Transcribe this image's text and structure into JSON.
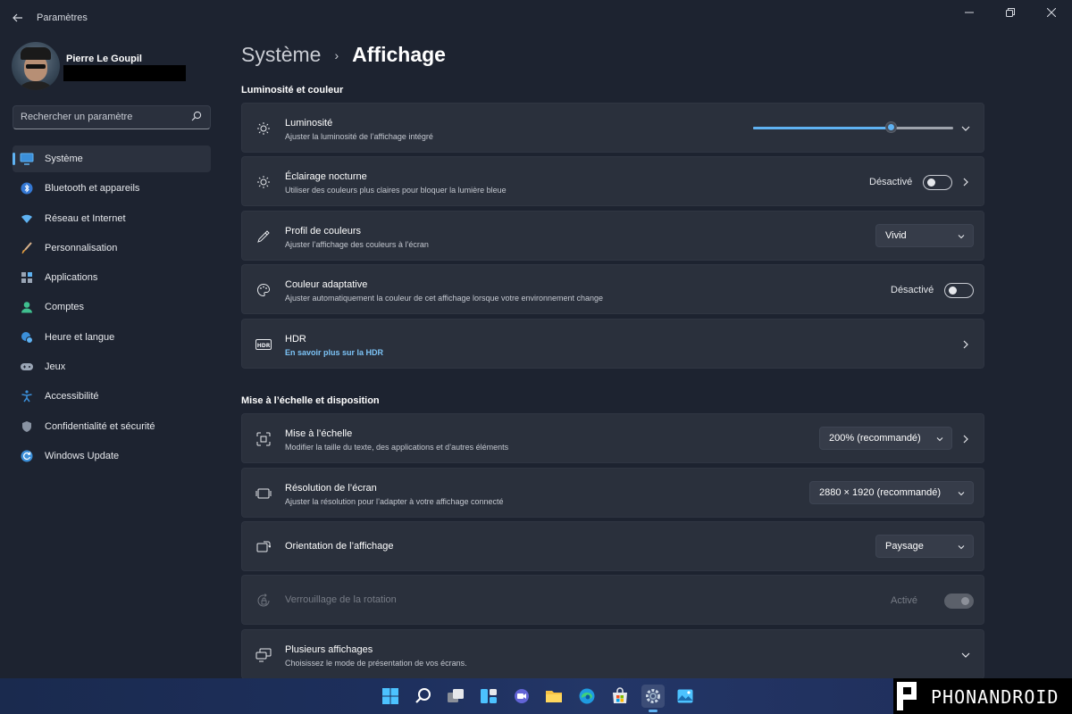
{
  "window": {
    "title": "Paramètres",
    "back_icon": "back-arrow-icon",
    "controls": [
      "minimize-icon",
      "restore-icon",
      "close-icon"
    ]
  },
  "profile": {
    "name": "Pierre Le Goupil",
    "email_redacted": true
  },
  "search": {
    "placeholder": "Rechercher un paramètre",
    "icon": "search-icon"
  },
  "sidebar": {
    "items": [
      {
        "label": "Système",
        "icon": "monitor-icon",
        "active": true
      },
      {
        "label": "Bluetooth et appareils",
        "icon": "bluetooth-icon"
      },
      {
        "label": "Réseau et Internet",
        "icon": "wifi-icon"
      },
      {
        "label": "Personnalisation",
        "icon": "brush-icon"
      },
      {
        "label": "Applications",
        "icon": "apps-icon"
      },
      {
        "label": "Comptes",
        "icon": "person-icon"
      },
      {
        "label": "Heure et langue",
        "icon": "globe-clock-icon"
      },
      {
        "label": "Jeux",
        "icon": "gamepad-icon"
      },
      {
        "label": "Accessibilité",
        "icon": "accessibility-icon"
      },
      {
        "label": "Confidentialité et sécurité",
        "icon": "shield-icon"
      },
      {
        "label": "Windows Update",
        "icon": "windows-update-icon"
      }
    ]
  },
  "breadcrumb": {
    "parent": "Système",
    "separator": "›",
    "current": "Affichage"
  },
  "sections": {
    "brightness_color": "Luminosité et couleur",
    "scale_layout": "Mise à l’échelle et disposition"
  },
  "cards": {
    "brightness": {
      "title": "Luminosité",
      "subtitle": "Ajuster la luminosité de l’affichage intégré",
      "value_fraction": 0.69
    },
    "night_light": {
      "title": "Éclairage nocturne",
      "subtitle": "Utiliser des couleurs plus claires pour bloquer la lumière bleue",
      "state": "Désactivé"
    },
    "color_profile": {
      "title": "Profil de couleurs",
      "subtitle": "Ajuster l’affichage des couleurs à l’écran",
      "value": "Vivid"
    },
    "adaptive_color": {
      "title": "Couleur adaptative",
      "subtitle": "Ajuster automatiquement la couleur de cet affichage lorsque votre environnement change",
      "state": "Désactivé"
    },
    "hdr": {
      "title": "HDR",
      "link": "En savoir plus sur la HDR",
      "icon_text": "HDR"
    },
    "scale": {
      "title": "Mise à l’échelle",
      "subtitle": "Modifier la taille du texte, des applications et d’autres éléments",
      "value": "200% (recommandé)"
    },
    "resolution": {
      "title": "Résolution de l’écran",
      "subtitle": "Ajuster  la résolution pour l’adapter à votre  affichage connecté",
      "value": "2880 × 1920 (recommandé)"
    },
    "orientation": {
      "title": "Orientation de l’affichage",
      "value": "Paysage"
    },
    "rotation_lock": {
      "title": "Verrouillage de la rotation",
      "state": "Activé",
      "disabled": true
    },
    "multiple_displays": {
      "title": "Plusieurs affichages",
      "subtitle": "Choisissez le mode de présentation de vos écrans."
    }
  },
  "taskbar": {
    "icons": [
      "windows-start-icon",
      "search-icon",
      "task-view-icon",
      "widgets-icon",
      "chat-icon",
      "file-explorer-icon",
      "edge-icon",
      "store-icon",
      "settings-icon",
      "photos-icon"
    ],
    "active": "settings-icon"
  },
  "watermark": {
    "text": "PHONANDROID"
  },
  "colors": {
    "accent": "#5fb2f2",
    "background": "#1d2330",
    "card": "#2a303c",
    "link": "#7cc3f6"
  }
}
